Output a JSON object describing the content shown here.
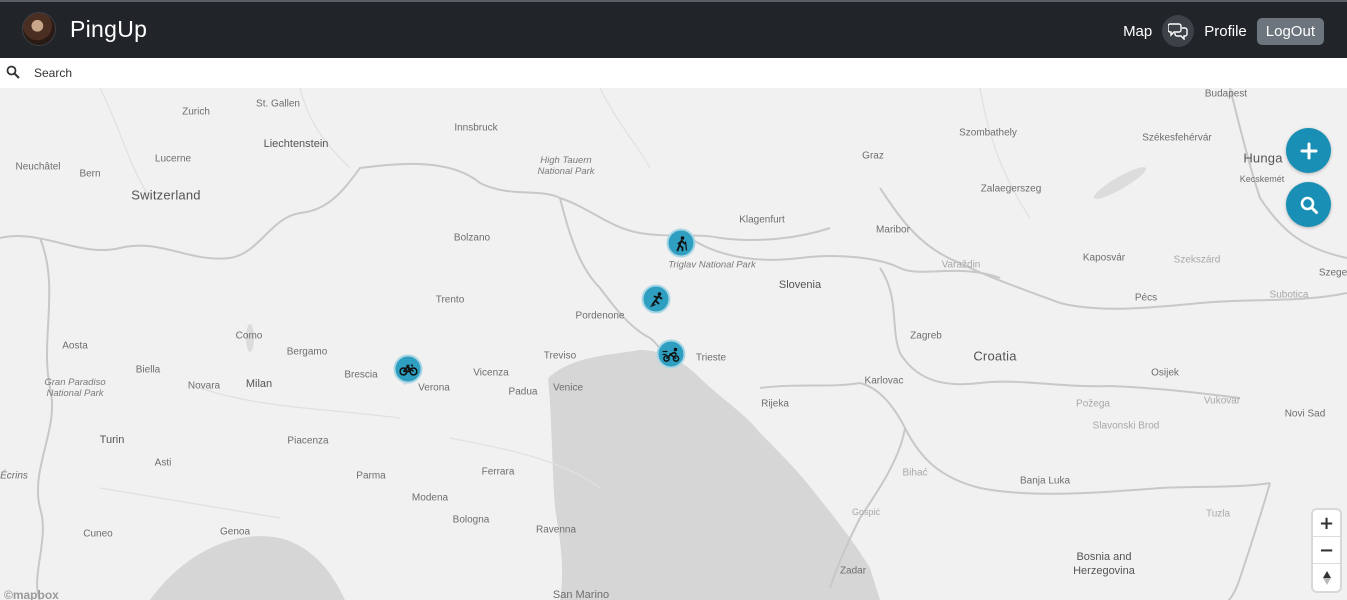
{
  "app": {
    "name": "PingUp"
  },
  "nav": {
    "map_label": "Map",
    "profile_label": "Profile",
    "logout_label": "LogOut"
  },
  "search": {
    "placeholder": "Search"
  },
  "map": {
    "labels": {
      "budapest": "Budapest",
      "zurich": "Zurich",
      "st_gallen": "St. Gallen",
      "innsbruck": "Innsbruck",
      "liechtenstein": "Liechtenstein",
      "szombathely": "Szombathely",
      "szekesfehervar": "Székesfehérvár",
      "neuchatel": "Neuchâtel",
      "bern": "Bern",
      "lucerne": "Lucerne",
      "high_tauern": "High Tauern National Park",
      "graz": "Graz",
      "hungary": "Hunga",
      "kecskemet": "Kecskemét",
      "switzerland": "Switzerland",
      "zalaegerszeg": "Zalaegerszeg",
      "klagenfurt": "Klagenfurt",
      "bolzano": "Bolzano",
      "maribor": "Maribor",
      "triglav": "Triglav National Park",
      "varazdin": "Varaždin",
      "kaposvar": "Kaposvár",
      "szekszard": "Szekszárd",
      "szeged": "Szege",
      "slovenia": "Slovenia",
      "trento": "Trento",
      "pecs": "Pécs",
      "subotica": "Subotica",
      "pordenone": "Pordenone",
      "aosta": "Aosta",
      "como": "Como",
      "zagreb": "Zagreb",
      "bergamo": "Bergamo",
      "treviso": "Treviso",
      "trieste": "Trieste",
      "croatia": "Croatia",
      "biella": "Biella",
      "brescia": "Brescia",
      "vicenza": "Vicenza",
      "karlovac": "Karlovac",
      "osijek": "Osijek",
      "gran_paradiso": "Gran Paradiso National Park",
      "novara": "Novara",
      "milan": "Milan",
      "verona": "Verona",
      "padua": "Padua",
      "venice": "Venice",
      "rijeka": "Rijeka",
      "pozega": "Požega",
      "vukovar": "Vukovar",
      "novi_sad": "Novi Sad",
      "slavonski_brod": "Slavonski Brod",
      "turin": "Turin",
      "piacenza": "Piacenza",
      "asti": "Asti",
      "ferrara": "Ferrara",
      "ecrins": "Écrins",
      "parma": "Parma",
      "bihac": "Bihać",
      "banja_luka": "Banja Luka",
      "modena": "Modena",
      "bologna": "Bologna",
      "gospic": "Gospić",
      "tuzla": "Tuzla",
      "cuneo": "Cuneo",
      "genoa": "Genoa",
      "ravenna": "Ravenna",
      "bosnia": "Bosnia and Herzegovina",
      "zadar": "Zadar",
      "san_marino": "San Marino"
    },
    "pins": [
      {
        "activity": "hiking",
        "icon": "hiking-icon"
      },
      {
        "activity": "skating",
        "icon": "skating-icon"
      },
      {
        "activity": "motocross",
        "icon": "motorcycle-icon"
      },
      {
        "activity": "cycling",
        "icon": "bicycle-icon"
      }
    ],
    "zoom_in": "+",
    "zoom_out": "−",
    "attribution": "©mapbox"
  },
  "colors": {
    "navbar": "#212529",
    "pin": "#2e9fc0",
    "fab": "#1a8fb5",
    "logout": "#6c757d"
  }
}
